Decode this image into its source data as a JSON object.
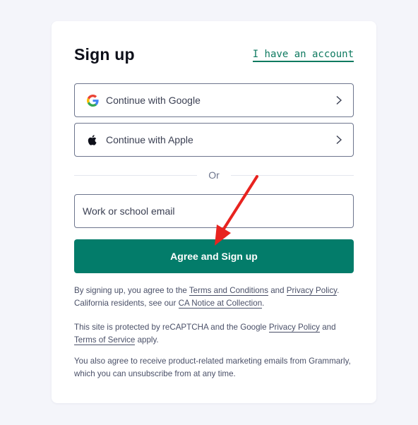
{
  "form": {
    "title": "Sign up",
    "login_link": "I have an account",
    "google_button": {
      "label": "Continue with Google",
      "icon": "google-g-icon"
    },
    "apple_button": {
      "label": "Continue with Apple",
      "icon": "apple-logo-icon"
    },
    "divider_text": "Or",
    "email": {
      "value": "",
      "placeholder": "Work or school email"
    },
    "submit_label": "Agree and Sign up"
  },
  "legal": {
    "p1": {
      "t1": "By signing up, you agree to the ",
      "terms_link": "Terms and Conditions",
      "t2": " and ",
      "privacy_link": "Privacy Policy",
      "t3": ". California residents, see our ",
      "ca_link": "CA Notice at Collection",
      "t4": "."
    },
    "p2": {
      "t1": "This site is protected by reCAPTCHA and the Google ",
      "privacy_link": "Privacy Policy",
      "t2": " and ",
      "terms_link": "Terms of Service",
      "t3": " apply."
    },
    "p3": {
      "text": "You also agree to receive product-related marketing emails from Grammarly, which you can unsubscribe from at any time."
    }
  },
  "colors": {
    "accent": "#037c6a",
    "link": "#0f7a60",
    "annotation_arrow": "#e8231f",
    "background": "#f4f5fa"
  }
}
